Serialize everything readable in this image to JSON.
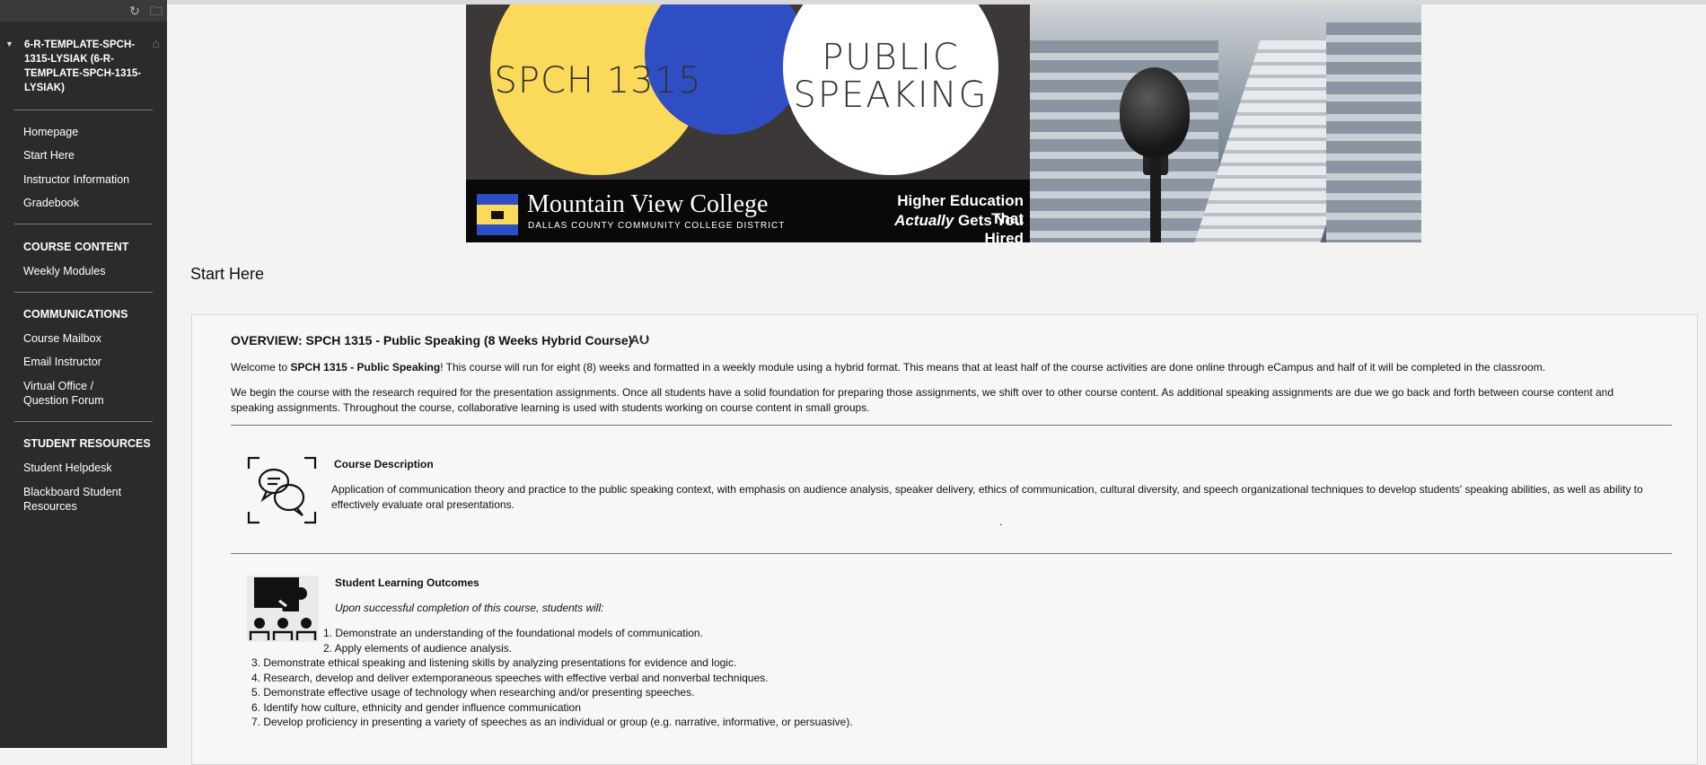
{
  "sidebar": {
    "course_title": "6-R-TEMPLATE-SPCH-1315-LYSIAK (6-R-TEMPLATE-SPCH-1315-LYSIAK)",
    "links_top": [
      "Homepage",
      "Start Here",
      "Instructor Information",
      "Gradebook"
    ],
    "course_content": {
      "heading": "COURSE CONTENT",
      "items": [
        "Weekly Modules"
      ]
    },
    "communications": {
      "heading": "COMMUNICATIONS",
      "items": [
        "Course Mailbox",
        "Email Instructor",
        "Virtual Office / Question Forum"
      ]
    },
    "student_resources": {
      "heading": "STUDENT RESOURCES",
      "items": [
        "Student Helpdesk",
        "Blackboard Student Resources"
      ]
    }
  },
  "banner": {
    "circle1": "SPCH 1315",
    "circle2_line1": "PUBLIC",
    "circle2_line2": "SPEAKING",
    "college": "Mountain View College",
    "district": "DALLAS COUNTY COMMUNITY COLLEGE DISTRICT",
    "tagline_line1": "Higher Education That",
    "tagline_em": "Actually",
    "tagline_rest": "Gets You Hired",
    "colors": {
      "yellow": "#fbd95a",
      "blue": "#2f4ec4",
      "dark": "#3d3838"
    }
  },
  "page_title": "Start Here",
  "overview": {
    "title": "OVERVIEW: SPCH 1315 - Public Speaking (8 Weeks Hybrid Course)",
    "welcome_prefix": "Welcome to ",
    "welcome_bold": "SPCH 1315 - Public Speaking",
    "welcome_rest": "! This course will run for eight (8) weeks and formatted in a weekly module using a hybrid format. This means that at least half of the course activities are done online through eCampus and half of it will be completed in the classroom.",
    "paragraph2": "We begin the course with the research required for the presentation assignments. Once all students have a solid foundation for preparing those assignments, we shift over to other course content. As additional speaking assignments are due we go back and forth between course content and speaking assignments. Throughout the course, collaborative learning is used with students working on course content in small groups."
  },
  "course_description": {
    "title": "Course Description",
    "text": "Application of communication theory and practice to the public speaking context, with emphasis on audience analysis, speaker delivery, ethics of communication, cultural diversity, and speech organizational techniques to develop students' speaking abilities, as well as ability to effectively evaluate oral presentations.",
    "dot": "."
  },
  "outcomes": {
    "title": "Student Learning Outcomes",
    "intro": "Upon successful completion of this course, students will:",
    "items": [
      "1. Demonstrate an understanding of the foundational models of communication.",
      "2. Apply elements of audience analysis.",
      "3. Demonstrate ethical speaking and listening skills by analyzing presentations for evidence and logic.",
      "4. Research, develop and deliver extemporaneous speeches with effective verbal and nonverbal techniques.",
      "5. Demonstrate effective usage of technology when researching and/or presenting speeches.",
      "6. Identify how culture, ethnicity and gender influence communication",
      "7. Develop proficiency in presenting a variety of speeches as an individual or group (e.g. narrative, informative, or persuasive)."
    ]
  }
}
